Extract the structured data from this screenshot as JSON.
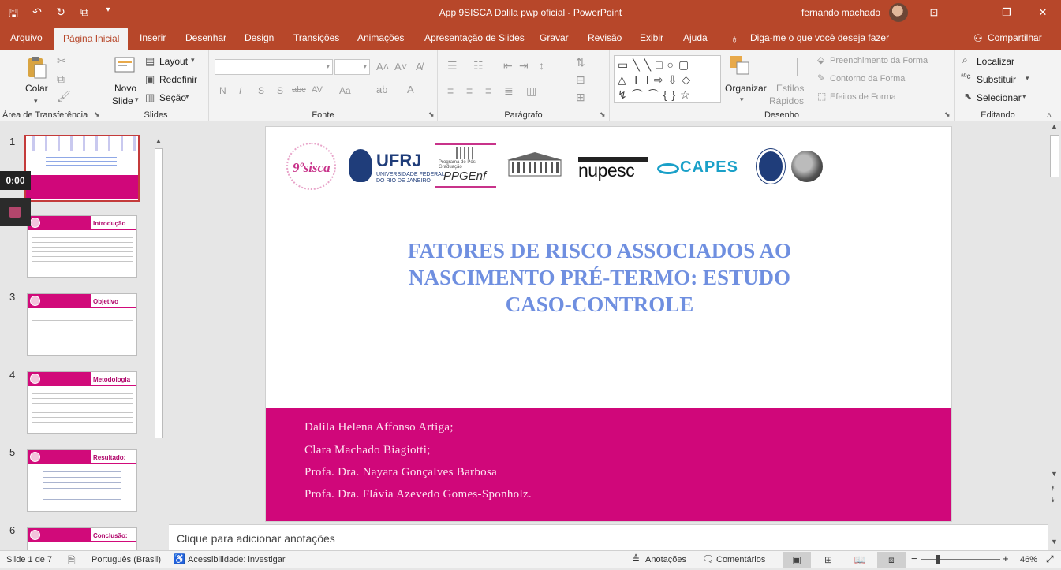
{
  "window": {
    "title": "App 9SISCA Dalila pwp oficial  -  PowerPoint",
    "user": "fernando machado",
    "qat_icons": [
      "save-icon",
      "undo-icon",
      "redo-icon",
      "present-from-start-icon",
      "customize-qat-icon"
    ]
  },
  "tabs": [
    "Arquivo",
    "Página Inicial",
    "Inserir",
    "Desenhar",
    "Design",
    "Transições",
    "Animações",
    "Apresentação de Slides",
    "Gravar",
    "Revisão",
    "Exibir",
    "Ajuda"
  ],
  "active_tab": "Página Inicial",
  "tell_me": "Diga-me o que você deseja fazer",
  "share": "Compartilhar",
  "ribbon": {
    "clipboard": {
      "label": "Área de Transferência",
      "paste": "Colar"
    },
    "slides": {
      "label": "Slides",
      "new_slide_1": "Novo",
      "new_slide_2": "Slide",
      "layout": "Layout",
      "reset": "Redefinir",
      "section": "Seção"
    },
    "font": {
      "label": "Fonte",
      "font_name": "",
      "font_size": "",
      "bold": "N",
      "italic": "I",
      "underline": "S",
      "shadow": "S",
      "strike": "abc",
      "case": "Aa"
    },
    "paragraph": {
      "label": "Parágrafo"
    },
    "drawing": {
      "label": "Desenho",
      "arrange": "Organizar",
      "quick_styles_1": "Estilos",
      "quick_styles_2": "Rápidos",
      "shape_fill": "Preenchimento da Forma",
      "shape_outline": "Contorno da Forma",
      "shape_effects": "Efeitos de Forma"
    },
    "editing": {
      "label": "Editando",
      "find": "Localizar",
      "replace": "Substituir",
      "select": "Selecionar"
    }
  },
  "thumbnails": [
    {
      "num": "1",
      "title": ""
    },
    {
      "num": "2",
      "title": "Introdução"
    },
    {
      "num": "3",
      "title": "Objetivo"
    },
    {
      "num": "4",
      "title": "Metodologia"
    },
    {
      "num": "5",
      "title": "Resultado:"
    },
    {
      "num": "6",
      "title": "Conclusão:"
    }
  ],
  "recording_timer": "0:00",
  "slide": {
    "logos": {
      "sisca": "9ºsisca",
      "ufrj": "UFRJ",
      "ufrj_sub1": "UNIVERSIDADE FEDERAL",
      "ufrj_sub2": "DO RIO DE JANEIRO",
      "ppgenf": "PPGEnf",
      "ppgenf_top": "Programa de Pós-Graduação",
      "nupesc": "nupesc",
      "capes": "CAPES"
    },
    "title_line1": "FATORES DE RISCO ASSOCIADOS AO",
    "title_line2": "NASCIMENTO PRÉ-TERMO: ESTUDO",
    "title_line3": "CASO-CONTROLE",
    "authors": [
      "Dalila Helena Affonso Artiga;",
      "Clara Machado Biagiotti;",
      "Profa. Dra. Nayara Gonçalves Barbosa",
      "Profa. Dra. Flávia Azevedo Gomes-Sponholz."
    ],
    "title_color": "#6f8fe0",
    "band_color": "#d0077a"
  },
  "notes_placeholder": "Clique para adicionar anotações",
  "status": {
    "slide_counter": "Slide 1 de 7",
    "language": "Português (Brasil)",
    "accessibility": "Acessibilidade: investigar",
    "notes": "Anotações",
    "comments": "Comentários",
    "zoom": "46%"
  },
  "colors": {
    "brand": "#b7472a",
    "accent_pink": "#d0077a"
  }
}
